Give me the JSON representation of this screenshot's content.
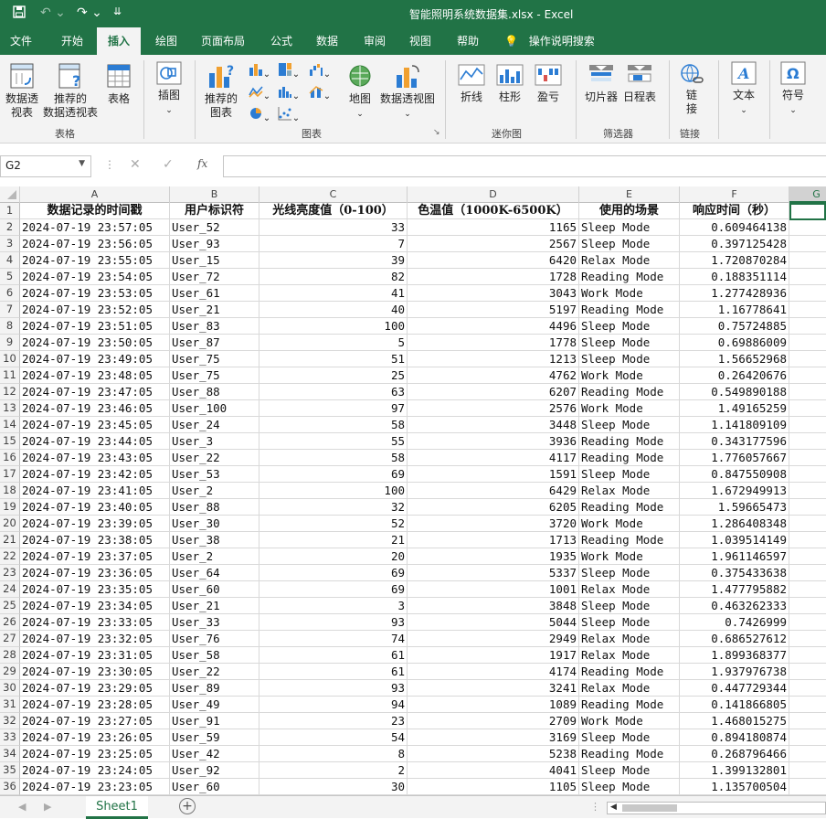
{
  "title": "智能照明系统数据集.xlsx  -  Excel",
  "menu_tabs": [
    "文件",
    "开始",
    "插入",
    "绘图",
    "页面布局",
    "公式",
    "数据",
    "审阅",
    "视图",
    "帮助"
  ],
  "active_tab": "插入",
  "tell_me": "操作说明搜索",
  "ribbon": {
    "pivot": "数据透\n视表",
    "rec_pivot": "推荐的\n数据透视表",
    "table": "表格",
    "illustrations": "插图",
    "rec_charts": "推荐的\n图表",
    "map": "地图",
    "pivot_chart": "数据透视图",
    "line": "折线",
    "column": "柱形",
    "winloss": "盈亏",
    "slicer": "切片器",
    "timeline": "日程表",
    "link": "链\n接",
    "text": "文本",
    "symbol": "符号",
    "groups": {
      "tables": "表格",
      "charts": "图表",
      "sparklines": "迷你图",
      "filters": "筛选器",
      "links": "链接"
    }
  },
  "name_box": "G2",
  "fx": "fx",
  "columns": [
    "A",
    "B",
    "C",
    "D",
    "E",
    "F",
    "G"
  ],
  "headers": [
    "数据记录的时间戳",
    "用户标识符",
    "光线亮度值（0-100）",
    "色温值（1000K-6500K）",
    "使用的场景",
    "响应时间（秒）"
  ],
  "rows": [
    [
      "2024-07-19 23:57:05",
      "User_52",
      "33",
      "1165",
      "Sleep Mode",
      "0.609464138"
    ],
    [
      "2024-07-19 23:56:05",
      "User_93",
      "7",
      "2567",
      "Sleep Mode",
      "0.397125428"
    ],
    [
      "2024-07-19 23:55:05",
      "User_15",
      "39",
      "6420",
      "Relax Mode",
      "1.720870284"
    ],
    [
      "2024-07-19 23:54:05",
      "User_72",
      "82",
      "1728",
      "Reading Mode",
      "0.188351114"
    ],
    [
      "2024-07-19 23:53:05",
      "User_61",
      "41",
      "3043",
      "Work Mode",
      "1.277428936"
    ],
    [
      "2024-07-19 23:52:05",
      "User_21",
      "40",
      "5197",
      "Reading Mode",
      "1.16778641"
    ],
    [
      "2024-07-19 23:51:05",
      "User_83",
      "100",
      "4496",
      "Sleep Mode",
      "0.75724885"
    ],
    [
      "2024-07-19 23:50:05",
      "User_87",
      "5",
      "1778",
      "Sleep Mode",
      "0.69886009"
    ],
    [
      "2024-07-19 23:49:05",
      "User_75",
      "51",
      "1213",
      "Sleep Mode",
      "1.56652968"
    ],
    [
      "2024-07-19 23:48:05",
      "User_75",
      "25",
      "4762",
      "Work Mode",
      "0.26420676"
    ],
    [
      "2024-07-19 23:47:05",
      "User_88",
      "63",
      "6207",
      "Reading Mode",
      "0.549890188"
    ],
    [
      "2024-07-19 23:46:05",
      "User_100",
      "97",
      "2576",
      "Work Mode",
      "1.49165259"
    ],
    [
      "2024-07-19 23:45:05",
      "User_24",
      "58",
      "3448",
      "Sleep Mode",
      "1.141809109"
    ],
    [
      "2024-07-19 23:44:05",
      "User_3",
      "55",
      "3936",
      "Reading Mode",
      "0.343177596"
    ],
    [
      "2024-07-19 23:43:05",
      "User_22",
      "58",
      "4117",
      "Reading Mode",
      "1.776057667"
    ],
    [
      "2024-07-19 23:42:05",
      "User_53",
      "69",
      "1591",
      "Sleep Mode",
      "0.847550908"
    ],
    [
      "2024-07-19 23:41:05",
      "User_2",
      "100",
      "6429",
      "Relax Mode",
      "1.672949913"
    ],
    [
      "2024-07-19 23:40:05",
      "User_88",
      "32",
      "6205",
      "Reading Mode",
      "1.59665473"
    ],
    [
      "2024-07-19 23:39:05",
      "User_30",
      "52",
      "3720",
      "Work Mode",
      "1.286408348"
    ],
    [
      "2024-07-19 23:38:05",
      "User_38",
      "21",
      "1713",
      "Reading Mode",
      "1.039514149"
    ],
    [
      "2024-07-19 23:37:05",
      "User_2",
      "20",
      "1935",
      "Work Mode",
      "1.961146597"
    ],
    [
      "2024-07-19 23:36:05",
      "User_64",
      "69",
      "5337",
      "Sleep Mode",
      "0.375433638"
    ],
    [
      "2024-07-19 23:35:05",
      "User_60",
      "69",
      "1001",
      "Relax Mode",
      "1.477795882"
    ],
    [
      "2024-07-19 23:34:05",
      "User_21",
      "3",
      "3848",
      "Sleep Mode",
      "0.463262333"
    ],
    [
      "2024-07-19 23:33:05",
      "User_33",
      "93",
      "5044",
      "Sleep Mode",
      "0.7426999"
    ],
    [
      "2024-07-19 23:32:05",
      "User_76",
      "74",
      "2949",
      "Relax Mode",
      "0.686527612"
    ],
    [
      "2024-07-19 23:31:05",
      "User_58",
      "61",
      "1917",
      "Relax Mode",
      "1.899368377"
    ],
    [
      "2024-07-19 23:30:05",
      "User_22",
      "61",
      "4174",
      "Reading Mode",
      "1.937976738"
    ],
    [
      "2024-07-19 23:29:05",
      "User_89",
      "93",
      "3241",
      "Relax Mode",
      "0.447729344"
    ],
    [
      "2024-07-19 23:28:05",
      "User_49",
      "94",
      "1089",
      "Reading Mode",
      "0.141866805"
    ],
    [
      "2024-07-19 23:27:05",
      "User_91",
      "23",
      "2709",
      "Work Mode",
      "1.468015275"
    ],
    [
      "2024-07-19 23:26:05",
      "User_59",
      "54",
      "3169",
      "Sleep Mode",
      "0.894180874"
    ],
    [
      "2024-07-19 23:25:05",
      "User_42",
      "8",
      "5238",
      "Reading Mode",
      "0.268796466"
    ],
    [
      "2024-07-19 23:24:05",
      "User_92",
      "2",
      "4041",
      "Sleep Mode",
      "1.399132801"
    ],
    [
      "2024-07-19 23:23:05",
      "User_60",
      "30",
      "1105",
      "Sleep Mode",
      "1.135700504"
    ]
  ],
  "sheet_tab": "Sheet1",
  "add_sheet": "+",
  "colors": {
    "excel_green": "#217346"
  }
}
